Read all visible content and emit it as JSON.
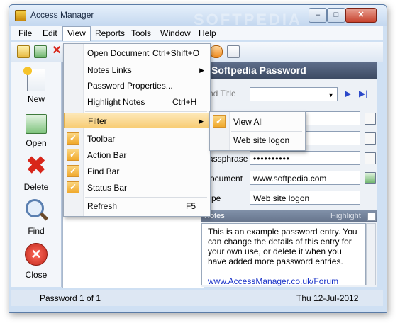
{
  "window": {
    "title": "Access Manager",
    "minimize_glyph": "–",
    "maximize_glyph": "□",
    "close_glyph": "✕",
    "watermark": "SOFTPEDIA"
  },
  "menubar": {
    "items": [
      "File",
      "Edit",
      "View",
      "Reports",
      "Tools",
      "Window",
      "Help"
    ],
    "active": "View"
  },
  "view_menu": {
    "items": [
      {
        "label": "Open Document",
        "shortcut": "Ctrl+Shift+O",
        "checked": false
      },
      {
        "label": "Notes Links",
        "shortcut": "",
        "submenu": true,
        "checked": false
      },
      {
        "label": "Password Properties...",
        "shortcut": "",
        "checked": false
      },
      {
        "label": "Highlight Notes",
        "shortcut": "Ctrl+H",
        "checked": false
      },
      {
        "label": "Filter",
        "shortcut": "",
        "submenu": true,
        "checked": false,
        "highlighted": true
      },
      {
        "label": "Toolbar",
        "shortcut": "",
        "checked": true
      },
      {
        "label": "Action Bar",
        "shortcut": "",
        "checked": true
      },
      {
        "label": "Find Bar",
        "shortcut": "",
        "checked": true
      },
      {
        "label": "Status Bar",
        "shortcut": "",
        "checked": true
      },
      {
        "label": "Refresh",
        "shortcut": "F5",
        "checked": false
      }
    ],
    "check_glyph": "✓",
    "submenu_arrow": "▶"
  },
  "filter_submenu": {
    "items": [
      {
        "label": "View All",
        "checked": true
      },
      {
        "label": "Web site logon",
        "checked": false
      }
    ]
  },
  "action_bar": {
    "items": [
      {
        "label": "New",
        "icon": "new-document-icon"
      },
      {
        "label": "Open",
        "icon": "open-icon"
      },
      {
        "label": "Delete",
        "icon": "delete-x-icon"
      },
      {
        "label": "Find",
        "icon": "magnifier-icon"
      },
      {
        "label": "Close",
        "icon": "close-circle-icon"
      }
    ]
  },
  "detail": {
    "header": "Softpedia Password",
    "find_title_placeholder": "Find Title",
    "play_glyph": "▶",
    "next_glyph": "▶|",
    "fields": [
      {
        "label": "Passphrase",
        "label_visible": "assphrase",
        "value": "••••••••••"
      },
      {
        "label": "Document",
        "label_visible": "ocument",
        "value": "www.softpedia.com"
      },
      {
        "label": "Type",
        "label_visible": "pe",
        "value": "Web site logon"
      }
    ],
    "notes_label": "Notes",
    "highlight_label": "Highlight",
    "notes_text": "This is an example password entry.  You can change the details of this entry for your own use, or delete it when you have added more password entries.",
    "notes_link": "www.AccessManager.co.uk/Forum"
  },
  "status": {
    "left": "Password 1 of 1",
    "right": "Thu 12-Jul-2012"
  },
  "colors": {
    "accent_header": "#4a5872",
    "menu_highlight": "#f8cd75",
    "check_orange": "#f0a92d"
  }
}
